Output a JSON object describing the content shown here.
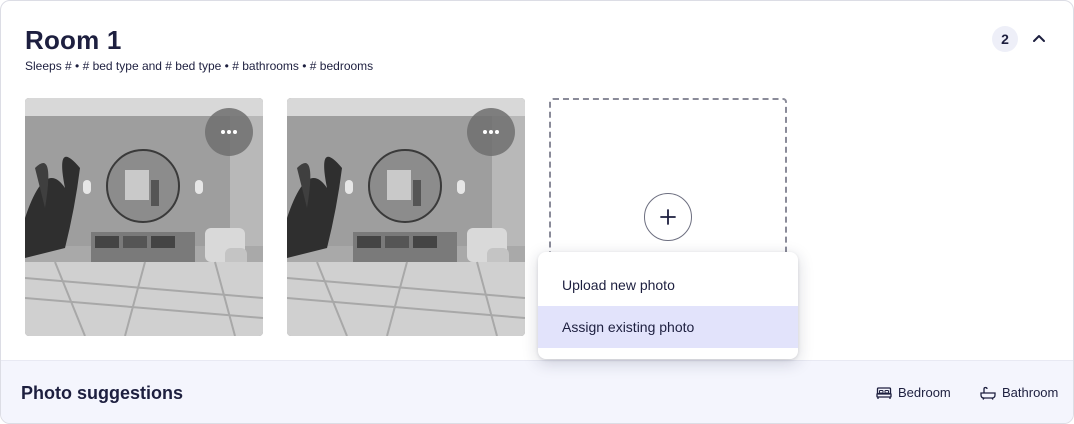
{
  "room": {
    "title": "Room 1",
    "subtitle": "Sleeps # • # bed type and # bed type • # bathrooms • # bedrooms",
    "photo_count": "2"
  },
  "photos": [
    {
      "more_icon": "ellipsis-icon"
    },
    {
      "more_icon": "ellipsis-icon"
    }
  ],
  "add_tile": {
    "icon": "plus-icon"
  },
  "menu": {
    "items": [
      {
        "label": "Upload new photo",
        "active": false
      },
      {
        "label": "Assign existing photo",
        "active": true
      }
    ]
  },
  "suggestions": {
    "title": "Photo suggestions",
    "chips": [
      {
        "label": "Bedroom",
        "icon": "bed-icon"
      },
      {
        "label": "Bathroom",
        "icon": "bathtub-icon"
      }
    ]
  },
  "colors": {
    "text": "#1d1f3f",
    "menu_active": "#e2e3fb",
    "suggest_bg": "#f4f5fd",
    "badge_bg": "#eeeff8"
  }
}
